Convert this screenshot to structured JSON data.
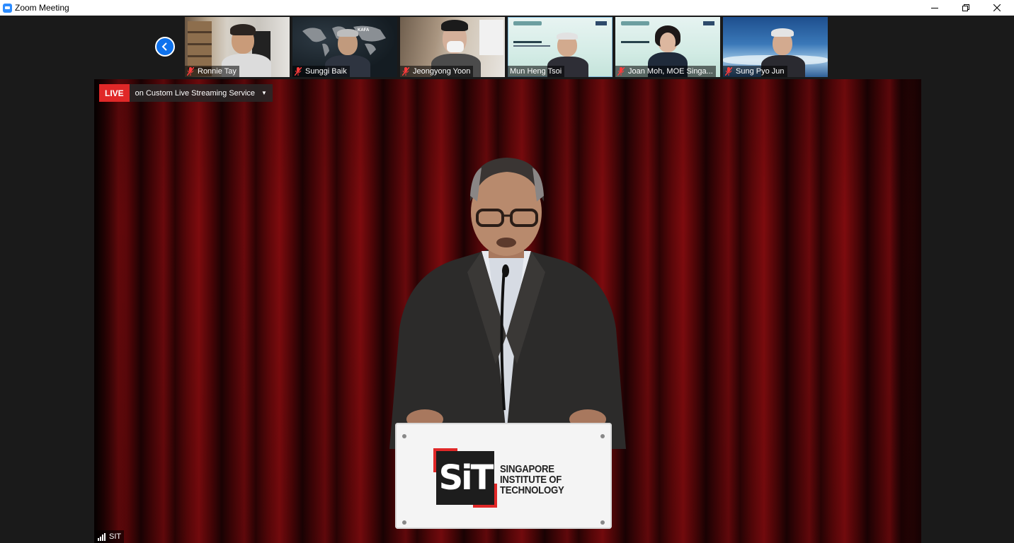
{
  "window": {
    "title": "Zoom Meeting"
  },
  "participants": [
    {
      "name": "Ronnie Tay",
      "muted": true
    },
    {
      "name": "Sunggi Baik",
      "muted": true
    },
    {
      "name": "Jeongyong Yoon",
      "muted": true
    },
    {
      "name": "Mun Heng Tsoi",
      "muted": false
    },
    {
      "name": "Joan Moh, MOE Singa...",
      "muted": true
    },
    {
      "name": "Sung Pyo Jun",
      "muted": true
    }
  ],
  "live": {
    "badge": "LIVE",
    "service": "on Custom Live Streaming Service"
  },
  "active_speaker": {
    "name": "SIT"
  },
  "podium": {
    "logo": "SiT",
    "line1": "SINGAPORE",
    "line2": "INSTITUTE OF",
    "line3": "TECHNOLOGY"
  },
  "colors": {
    "live": "#e02828",
    "zoom_blue": "#0e72ed",
    "curtain": "#6a090c"
  }
}
